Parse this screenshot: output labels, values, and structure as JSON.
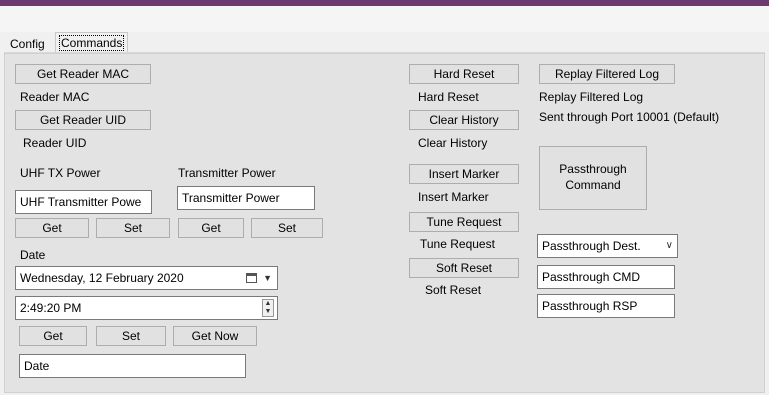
{
  "tabs": [
    {
      "label": "Config"
    },
    {
      "label": "Commands"
    }
  ],
  "left": {
    "get_reader_mac_button": "Get Reader MAC",
    "reader_mac_label": "Reader MAC",
    "get_reader_uid_button": "Get Reader UID",
    "reader_uid_label": "Reader UID",
    "uhf_tx_power_label": "UHF TX Power",
    "uhf_tx_power_value": "UHF Transmitter Powe",
    "transmitter_power_label": "Transmitter Power",
    "transmitter_power_value": "Transmitter Power",
    "get_label": "Get",
    "set_label": "Set",
    "date_label": "Date",
    "date_picker_value": "Wednesday, 12  February  2020",
    "time_picker_value": "2:49:20 PM",
    "get_now_label": "Get Now",
    "date_value": "Date"
  },
  "middle": {
    "hard_reset_button": "Hard Reset",
    "hard_reset_label": "Hard Reset",
    "clear_history_button": "Clear History",
    "clear_history_label": "Clear History",
    "insert_marker_button": "Insert Marker",
    "insert_marker_label": "Insert Marker",
    "tune_request_button": "Tune Request",
    "tune_request_label": "Tune Request",
    "soft_reset_button": "Soft Reset",
    "soft_reset_label": "Soft Reset"
  },
  "right": {
    "replay_filtered_log_button": "Replay Filtered Log",
    "replay_filtered_log_label": "Replay Filtered Log",
    "sent_through_port_label": "Sent through Port 10001 (Default)",
    "passthrough_command_button_line1": "Passthrough",
    "passthrough_command_button_line2": "Command",
    "passthrough_dest_value": "Passthrough Dest.",
    "passthrough_cmd_value": "Passthrough CMD",
    "passthrough_rsp_value": "Passthrough RSP"
  },
  "icons": {
    "dropdown": "chevron-down-icon",
    "calendar": "calendar-icon",
    "spinner": "spinner-icon"
  },
  "colors": {
    "titlebar": "#6b3a6e",
    "panel": "#e3e3e3",
    "button": "#e1e1e1"
  }
}
